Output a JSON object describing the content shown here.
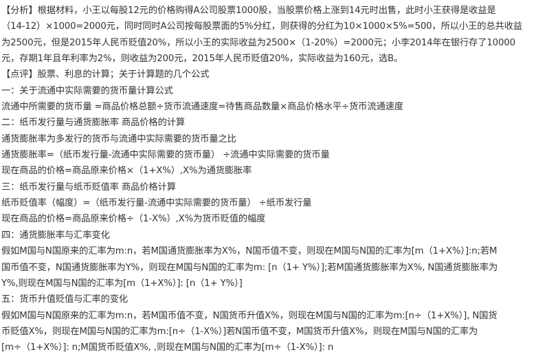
{
  "lines": [
    "【分析】根据材料，小王以每股12元的价格购得A公司股票1000股，当股票价格上涨到14元时出售，此时小王获得是收益是",
    "（14-12）×1000=2000元，同时同时A公司按每股票面的5%分红，则获得的分红为10×1000×5%=500，所以小王的总共收益",
    "为2500元，但是2015年人民币贬值20%，所以小王的实际收益为2500×（1-20%）=2000元；小李2014年在银行存了10000",
    "元，存期1年且年利率为2%，则收益为200元，2015年人民币贬值20%，实际收益为160元，选B。",
    "【点评】股票、利息的计算；关于计算题的几个公式",
    "一：关于流通中实际需要的货币量计算公式",
    "流通中所需要的货币量 =商品价格总额÷货币流通速度=待售商品数量×商品价格水平÷货币流通速度",
    "二：纸币发行量与通货膨胀率 商品价格的计算",
    "通货膨胀率为多发行的货币与流通中实际需要的货币量之比",
    "通货膨胀率=（纸币发行量-流通中实际需要的货币量） ÷流通中实际需要的货币量",
    "现在商品的价格=商品原来价格×（1+X%）,X%为通货膨胀率",
    "三：纸币发行量与纸币贬值率 商品价格计算",
    "纸币贬值率（幅度）=（纸币发行量-流通中实际需要的货币量） ÷纸币发行量",
    "现在商品的价格=商品原来价格÷（1-X%）,X%为货币贬值的幅度",
    "四：通货膨胀率与汇率变化",
    "假如M国与N国原来的汇率为m:n，若M国通货膨胀率为X%，N国币值不变，则现在M国与N国的汇率为[m（1+X%）]:n;若M",
    "国币值不变，N国通货膨胀率为Y%，则现在M国与N国的汇率为m: [n（1+ Y%）];若M国通货膨胀率为X%, N国通货膨胀率为",
    "Y%,则现在M国与N国的汇率为[m（1+X%）]: [n（1+ Y%）]",
    "五：货币升值贬值与汇率的变化",
    "假如M国与N国原来的汇率为m:n，若M国币值不变，N国货币升值X%，则现在M国与N国的汇率为m:[n÷（1+X%）], N国货",
    "币贬值X%，则现在M国与N国的汇率为m:[n÷（1-X%）]若N国币值不变，M国货币升值X%，则现在M国与N国的汇率为",
    "[m÷（1+X%）]: n;M国货币贬值X%, ,则现在M国与N国的汇率为[m÷（1-X%）]: n"
  ]
}
